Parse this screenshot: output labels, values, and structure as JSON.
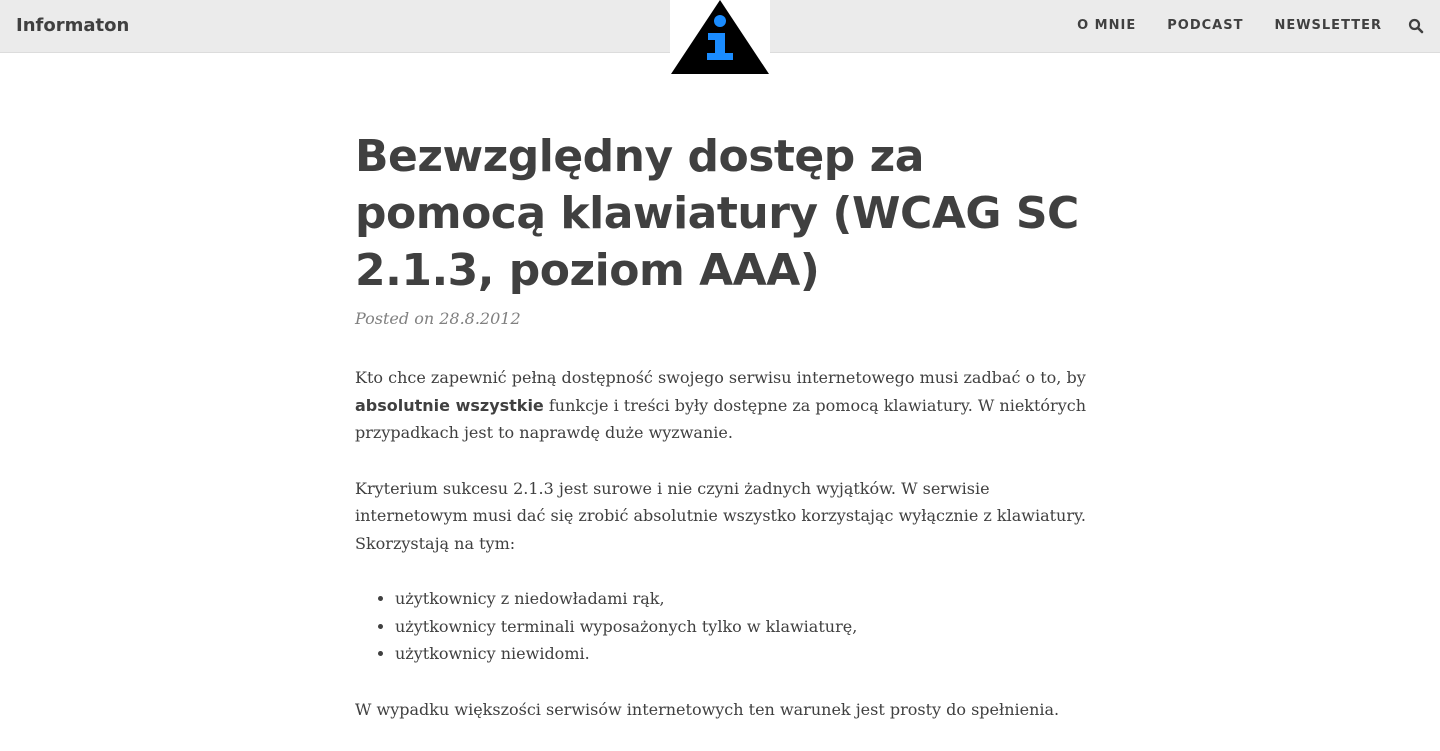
{
  "nav": {
    "brand": "Informaton",
    "logo_icon": "info-warning-triangle-icon",
    "items": [
      {
        "label": "O MNIE"
      },
      {
        "label": "PODCAST"
      },
      {
        "label": "NEWSLETTER"
      }
    ],
    "search_icon": "search-icon"
  },
  "article": {
    "title": "Bezwzględny dostęp za pomocą klawiatury (WCAG SC 2.1.3, poziom AAA)",
    "meta": "Posted on 28.8.2012",
    "p1_before": "Kto chce zapewnić pełną dostępność swojego serwisu internetowego musi zadbać o to, by ",
    "p1_bold": "absolutnie wszystkie",
    "p1_after": " funkcje i treści były dostępne za pomocą klawiatury. W niektórych przypadkach jest to naprawdę duże wyzwanie.",
    "p2": "Kryterium sukcesu 2.1.3 jest surowe i nie czyni żadnych wyjątków. W serwisie internetowym musi dać się zrobić absolutnie wszystko korzystając wyłącznie z klawiatury. Skorzystają na tym:",
    "list": [
      "użytkownicy z niedowładami rąk,",
      "użytkownicy terminali wyposażonych tylko w klawiaturę,",
      "użytkownicy niewidomi."
    ],
    "p3": "W wypadku większości serwisów internetowych ten warunek jest prosty do spełnienia."
  },
  "colors": {
    "navbar_bg": "#ebebeb",
    "text": "#404040",
    "meta": "#808080",
    "logo_blue": "#1a8cff",
    "logo_black": "#000000"
  }
}
